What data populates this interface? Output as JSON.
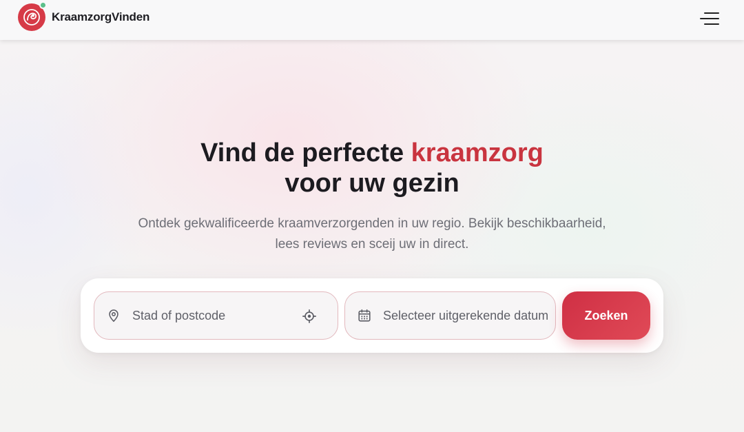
{
  "header": {
    "brand": "KraamzorgVinden",
    "logo_icon": "mother-baby-icon",
    "menu_icon": "hamburger-menu-icon"
  },
  "hero": {
    "title_part1": "Vind de perfecte ",
    "title_accent": "kraamzorg",
    "title_line2": "voor uw gezin",
    "subtitle_line1": "Ontdek gekwalificeerde kraamverzorgenden in uw regio. Bekijk beschikbaarheid,",
    "subtitle_line2": "lees reviews en sceij uw in direct."
  },
  "search": {
    "location_placeholder": "Stad of postcode",
    "location_icon": "map-pin-icon",
    "locate_icon": "crosshair-icon",
    "date_placeholder": "Selecteer uitgerekende datum",
    "date_icon": "calendar-icon",
    "button_label": "Zoeken"
  },
  "colors": {
    "brand": "#d63a47",
    "accent_text": "#c9343f",
    "online_dot": "#5bbf8a",
    "button": "#d63a47"
  }
}
